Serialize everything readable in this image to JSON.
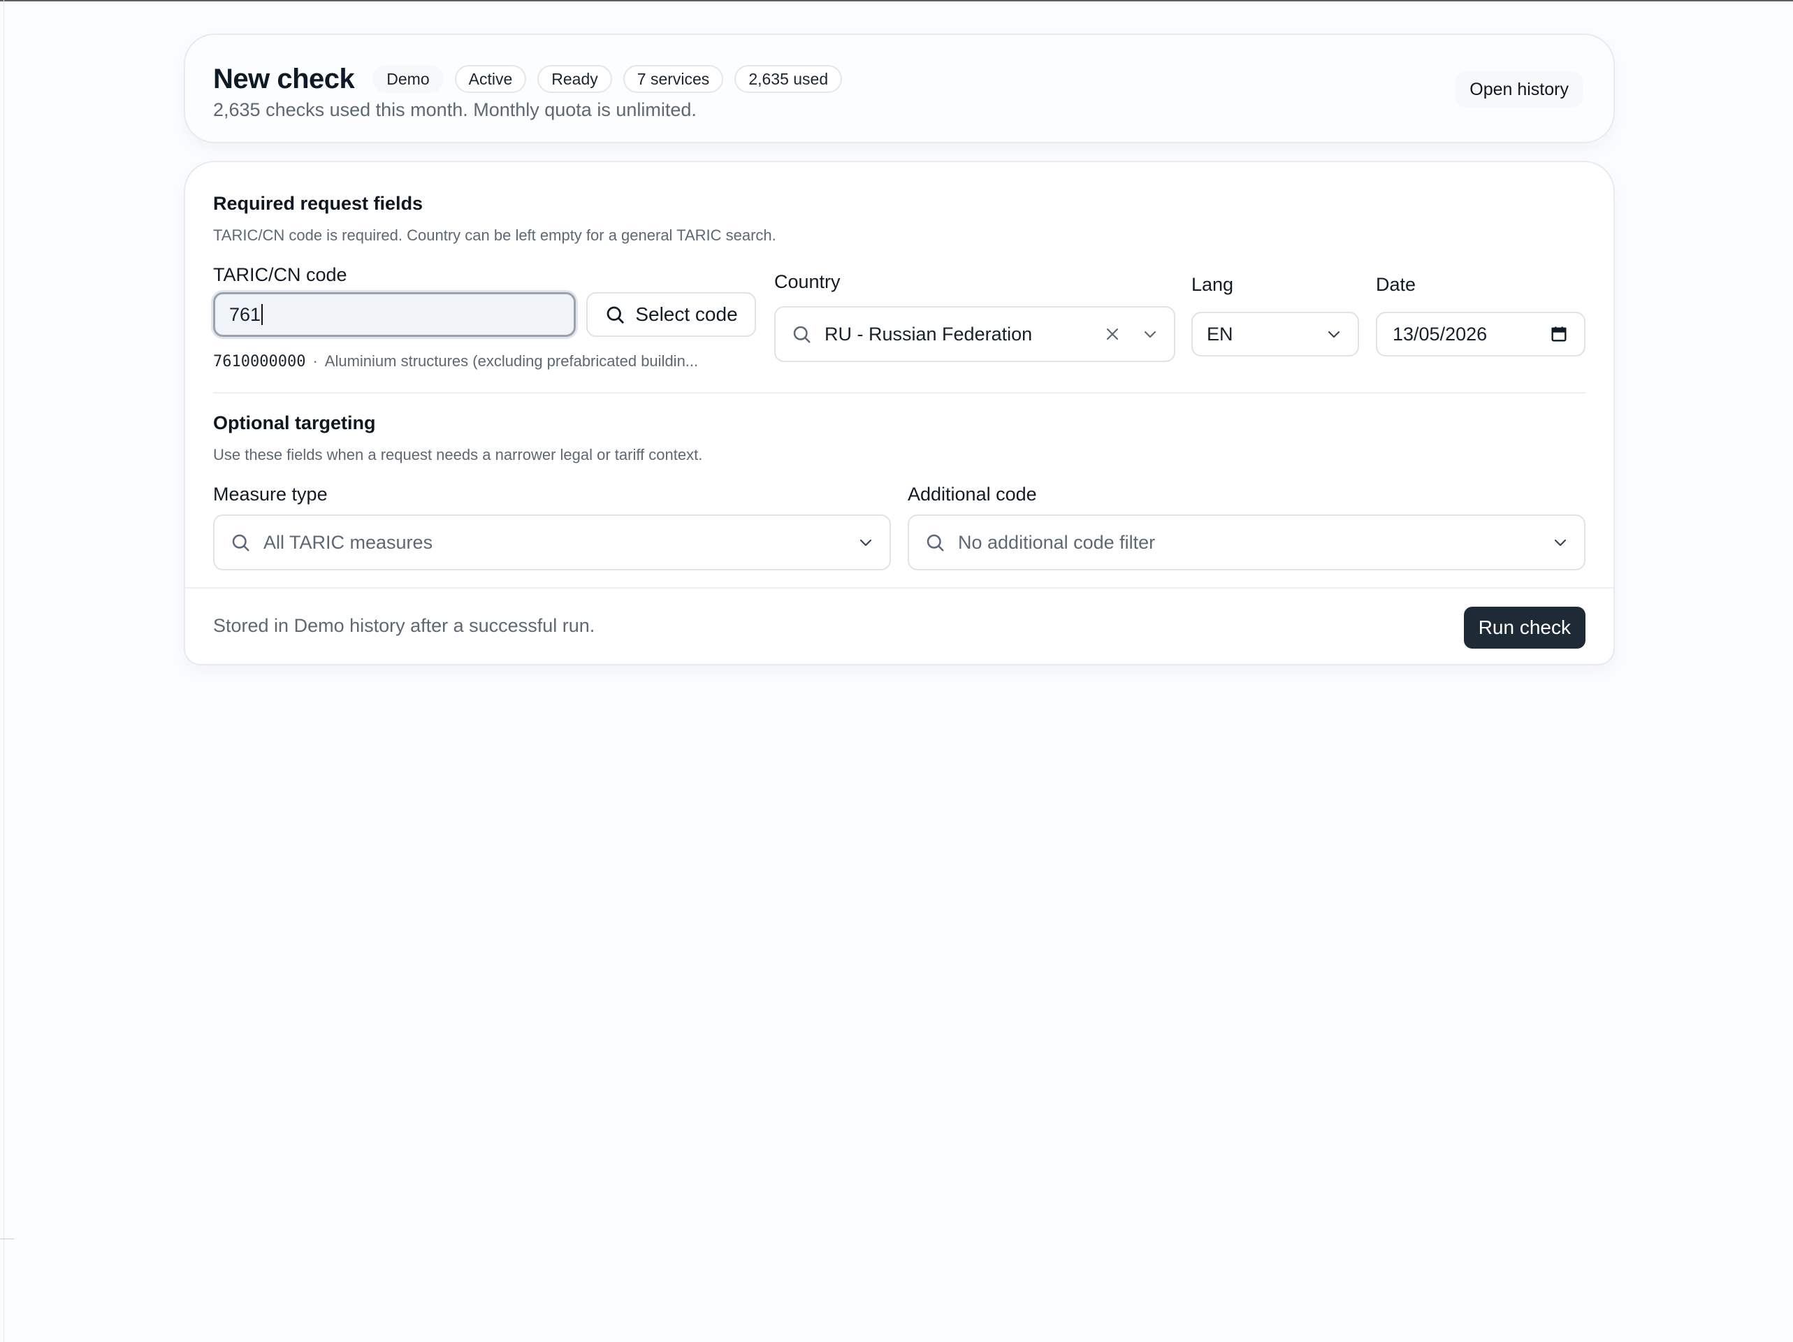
{
  "header": {
    "title": "New check",
    "badges": [
      "Demo",
      "Active",
      "Ready",
      "7 services",
      "2,635 used"
    ],
    "subtitle": "2,635 checks used this month. Monthly quota is unlimited.",
    "open_history_label": "Open history"
  },
  "required": {
    "title": "Required request fields",
    "description": "TARIC/CN code is required. Country can be left empty for a general TARIC search.",
    "code_label": "TARIC/CN code",
    "code_value": "761",
    "select_code_label": "Select code",
    "code_hint_code": "7610000000",
    "code_hint_separator": "·",
    "code_hint_text": "Aluminium structures (excluding prefabricated buildin...",
    "country_label": "Country",
    "country_value": "RU - Russian Federation",
    "lang_label": "Lang",
    "lang_value": "EN",
    "date_label": "Date",
    "date_value": "13/05/2026"
  },
  "optional": {
    "title": "Optional targeting",
    "description": "Use these fields when a request needs a narrower legal or tariff context.",
    "measure_label": "Measure type",
    "measure_placeholder": "All TARIC measures",
    "addcode_label": "Additional code",
    "addcode_placeholder": "No additional code filter"
  },
  "footer": {
    "note": "Stored in Demo history after a successful run.",
    "run_label": "Run check"
  },
  "colors": {
    "primary_button": "#1f2a37",
    "muted_text": "#5d6874",
    "border": "#dfe3e8"
  },
  "icons": [
    "search-icon",
    "close-icon",
    "chevron-down-icon",
    "calendar-icon"
  ]
}
